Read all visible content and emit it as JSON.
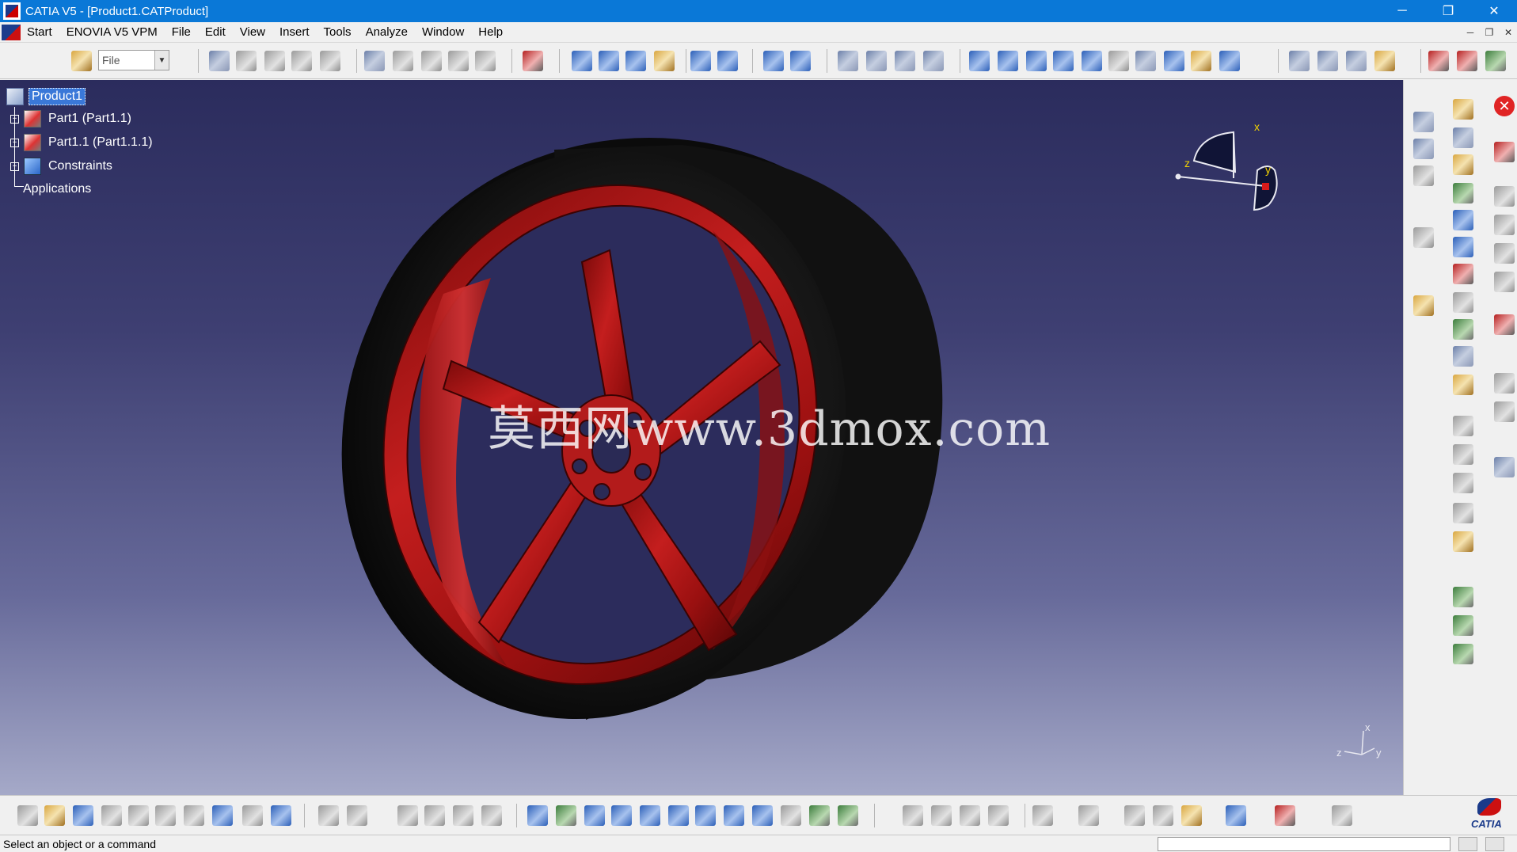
{
  "window": {
    "title": "CATIA V5 - [Product1.CATProduct]",
    "controls": {
      "minimize": "─",
      "restore": "❐",
      "close": "✕"
    }
  },
  "menubar": {
    "items": [
      "Start",
      "ENOVIA V5 VPM",
      "File",
      "Edit",
      "View",
      "Insert",
      "Tools",
      "Analyze",
      "Window",
      "Help"
    ],
    "mdi_controls": {
      "minimize": "─",
      "restore": "❐",
      "close": "✕"
    }
  },
  "toolbar": {
    "file_combo": {
      "value": "File",
      "arrow": "▼"
    }
  },
  "tree": {
    "root": "Product1",
    "children": [
      "Part1 (Part1.1)",
      "Part1.1 (Part1.1.1)",
      "Constraints"
    ],
    "applications": "Applications",
    "expander": "+"
  },
  "viewport": {
    "watermark": "莫西网www.3dmox.com",
    "compass": {
      "x": "x",
      "y": "y",
      "z": "z"
    },
    "axis_triad": {
      "x": "x",
      "y": "y",
      "z": "z"
    },
    "colors": {
      "rim": "#b01818",
      "tire": "#121212",
      "background_top": "#2b2c5d",
      "background_bottom": "#a5a9c8"
    }
  },
  "right_dock": {
    "close_symbol": "✕"
  },
  "statusbar": {
    "text": "Select an object or a command"
  },
  "logo": {
    "text": "CATIA"
  }
}
